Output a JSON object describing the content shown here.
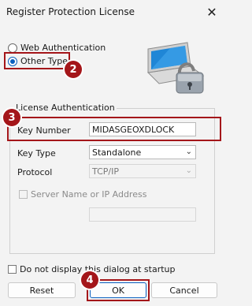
{
  "window": {
    "title": "Register Protection License",
    "close_glyph": "✕"
  },
  "auth_type": {
    "web_label": "Web Authentication",
    "other_label": "Other Type",
    "selected": "Other Type"
  },
  "license_auth": {
    "group_title": "License Authentication",
    "key_number_label": "Key Number",
    "key_number_value": "MIDASGEOXDLOCK",
    "key_type_label": "Key Type",
    "key_type_value": "Standalone",
    "protocol_label": "Protocol",
    "protocol_value": "TCP/IP",
    "server_label": "Server Name or IP Address",
    "server_value": ""
  },
  "startup_checkbox_label": "Do not display this dialog at startup",
  "buttons": {
    "reset": "Reset",
    "ok": "OK",
    "cancel": "Cancel"
  },
  "callouts": {
    "c2": "2",
    "c3": "3",
    "c4": "4"
  },
  "colors": {
    "highlight": "#a4161a",
    "accent": "#0a5fbf"
  },
  "icons": {
    "license": "laptop-with-padlock-icon",
    "close": "close-icon"
  }
}
